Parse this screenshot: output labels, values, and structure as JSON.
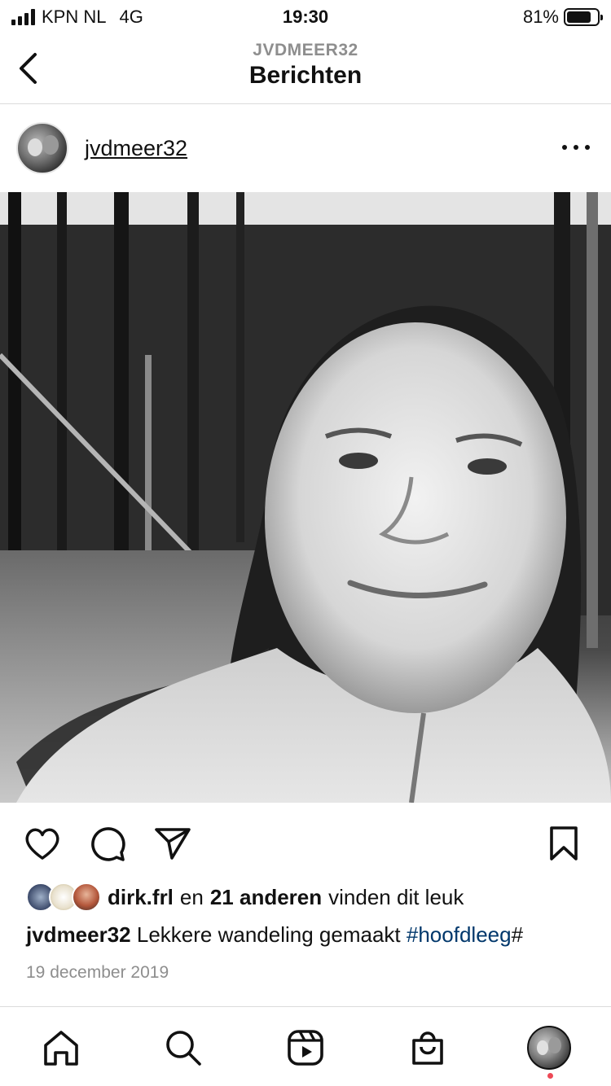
{
  "status_bar": {
    "carrier": "KPN NL",
    "network": "4G",
    "time": "19:30",
    "battery_percent": "81%",
    "battery_level": 0.81
  },
  "header": {
    "subtitle": "JVDMEER32",
    "title": "Berichten",
    "back_icon": "chevron-left-icon"
  },
  "post": {
    "username": "jvdmeer32",
    "more_icon": "more-horizontal-icon",
    "photo": "black-and-white selfie in forest",
    "actions": {
      "like_icon": "heart-icon",
      "comment_icon": "comment-icon",
      "share_icon": "send-icon",
      "save_icon": "bookmark-icon"
    },
    "likes": {
      "first_liker": "dirk.frl",
      "connector": "en",
      "others": "21 anderen",
      "suffix": "vinden dit leuk"
    },
    "caption": {
      "username": "jvdmeer32",
      "text": "Lekkere wandeling gemaakt",
      "hashtag": "#hoofdleeg",
      "trailing": "#"
    },
    "date": "19 december 2019"
  },
  "tabbar": {
    "items": [
      "home-icon",
      "search-icon",
      "reels-icon",
      "shop-icon",
      "profile-avatar"
    ]
  },
  "colors": {
    "hashtag": "#00376b",
    "muted": "#8e8e8e",
    "divider": "#dbdbdb",
    "notification": "#ed4956"
  }
}
